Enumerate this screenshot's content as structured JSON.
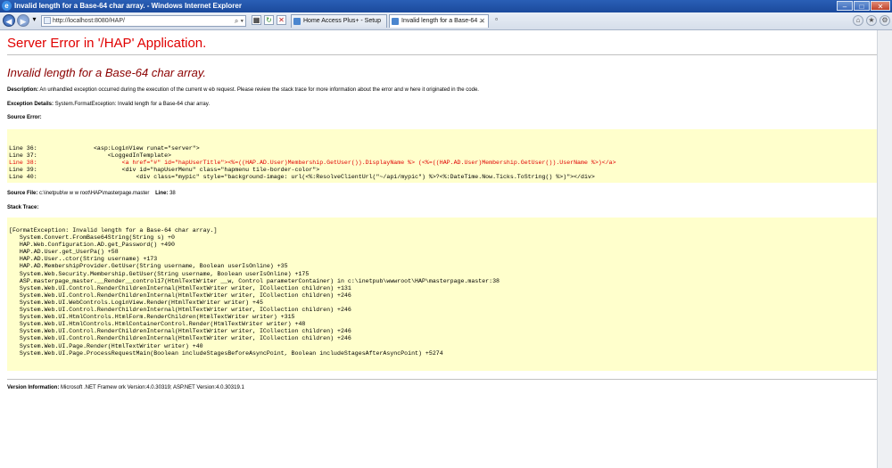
{
  "window": {
    "title": "Invalid length for a Base-64 char array. - Windows Internet Explorer",
    "buttons": {
      "minimize": "–",
      "maximize": "□",
      "close": "✕"
    }
  },
  "toolbar": {
    "address": "http://localhost:8080/HAP/",
    "tabs": [
      {
        "label": "Home Access Plus+ - Setup"
      },
      {
        "label": "Invalid length for a Base-64 ..."
      }
    ]
  },
  "page": {
    "heading": "Server Error in '/HAP' Application.",
    "error_title": "Invalid length for a Base-64 char array.",
    "description_label": "Description:",
    "description_text": " An unhandled exception occurred during the execution of the current w eb request. Please review the stack trace for more information about the error and w here it originated in the code.",
    "exception_label": "Exception Details:",
    "exception_text": " System.FormatException: Invalid length for a Base-64 char array.",
    "source_error_label": "Source Error:",
    "source_lines": [
      {
        "text": "Line 36:                <asp:LoginView runat=\"server\">",
        "highlight": false
      },
      {
        "text": "Line 37:                    <LoggedInTemplate>",
        "highlight": false
      },
      {
        "text": "Line 38:                        <a href=\"#\" id=\"hapUserTitle\"><%=((HAP.AD.User)Membership.GetUser()).DisplayName %> (<%=((HAP.AD.User)Membership.GetUser()).UserName %>)</a>",
        "highlight": true
      },
      {
        "text": "Line 39:                        <div id=\"hapUserMenu\" class=\"hapmenu tile-border-color\">",
        "highlight": false
      },
      {
        "text": "Line 40:                            <div class=\"mypic\" style=\"background-image: url(<%:ResolveClientUrl(\"~/api/mypic\") %>?<%:DateTime.Now.Ticks.ToString() %>)\"></div>",
        "highlight": false
      }
    ],
    "source_file_label": "Source File:",
    "source_file_value": " c:\\inetpub\\w w w root\\HAP\\masterpage.master",
    "line_label": "Line:",
    "line_value": " 38",
    "stack_trace_label": "Stack Trace:",
    "stack_lines": [
      "[FormatException: Invalid length for a Base-64 char array.]",
      "   System.Convert.FromBase64String(String s) +0",
      "   HAP.Web.Configuration.AD.get_Password() +490",
      "   HAP.AD.User.get_UserPa() +58",
      "   HAP.AD.User..ctor(String username) +173",
      "   HAP.AD.MembershipProvider.GetUser(String username, Boolean userIsOnline) +35",
      "   System.Web.Security.Membership.GetUser(String username, Boolean userIsOnline) +175",
      "   ASP.masterpage_master.__Render__control17(HtmlTextWriter __w, Control parameterContainer) in c:\\inetpub\\wwwroot\\HAP\\masterpage.master:38",
      "   System.Web.UI.Control.RenderChildrenInternal(HtmlTextWriter writer, ICollection children) +131",
      "   System.Web.UI.Control.RenderChildrenInternal(HtmlTextWriter writer, ICollection children) +246",
      "   System.Web.UI.WebControls.LoginView.Render(HtmlTextWriter writer) +45",
      "   System.Web.UI.Control.RenderChildrenInternal(HtmlTextWriter writer, ICollection children) +246",
      "   System.Web.UI.HtmlControls.HtmlForm.RenderChildren(HtmlTextWriter writer) +315",
      "   System.Web.UI.HtmlControls.HtmlContainerControl.Render(HtmlTextWriter writer) +48",
      "   System.Web.UI.Control.RenderChildrenInternal(HtmlTextWriter writer, ICollection children) +246",
      "   System.Web.UI.Control.RenderChildrenInternal(HtmlTextWriter writer, ICollection children) +246",
      "   System.Web.UI.Page.Render(HtmlTextWriter writer) +40",
      "   System.Web.UI.Page.ProcessRequestMain(Boolean includeStagesBeforeAsyncPoint, Boolean includeStagesAfterAsyncPoint) +5274"
    ],
    "version_label": "Version Information:",
    "version_text": " Microsoft .NET Framew ork Version:4.0.30319; ASP.NET Version:4.0.30319.1"
  },
  "colors": {
    "heading": "#e00000",
    "error_title": "#8b0000",
    "code_bg": "#ffffcc",
    "titlebar": "#1b4a9c"
  },
  "icons": [
    "ie-logo-icon",
    "back-icon",
    "forward-icon",
    "dropdown-icon",
    "search-icon",
    "refresh-icon",
    "stop-icon",
    "compat-icon",
    "home-icon",
    "favorites-icon",
    "tools-icon"
  ]
}
